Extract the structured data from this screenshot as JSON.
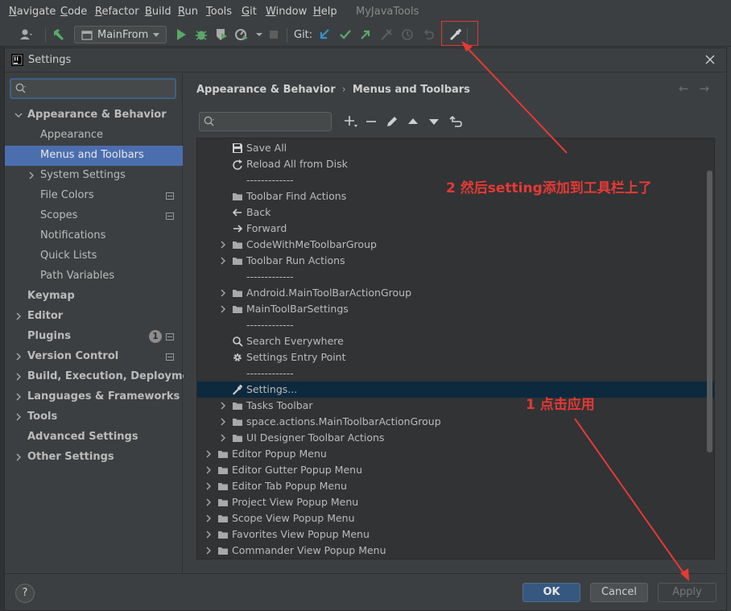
{
  "menubar": {
    "items": [
      "Navigate",
      "Code",
      "Refactor",
      "Build",
      "Run",
      "Tools",
      "Git",
      "Window",
      "Help"
    ],
    "app_title": "MyJavaTools"
  },
  "toolbar": {
    "run_config": "MainFrom",
    "git_label": "Git:"
  },
  "dialog": {
    "title": "Settings",
    "search_placeholder": "",
    "sidebar": [
      {
        "label": "Appearance & Behavior",
        "bold": true,
        "level": 0,
        "expanded": true
      },
      {
        "label": "Appearance",
        "bold": false,
        "level": 1
      },
      {
        "label": "Menus and Toolbars",
        "bold": false,
        "level": 1,
        "selected": true
      },
      {
        "label": "System Settings",
        "bold": false,
        "level": 1,
        "collapsed": true
      },
      {
        "label": "File Colors",
        "bold": false,
        "level": 1,
        "mark": true
      },
      {
        "label": "Scopes",
        "bold": false,
        "level": 1,
        "mark": true
      },
      {
        "label": "Notifications",
        "bold": false,
        "level": 1
      },
      {
        "label": "Quick Lists",
        "bold": false,
        "level": 1
      },
      {
        "label": "Path Variables",
        "bold": false,
        "level": 1
      },
      {
        "label": "Keymap",
        "bold": true,
        "level": 0
      },
      {
        "label": "Editor",
        "bold": true,
        "level": 0,
        "collapsed": true
      },
      {
        "label": "Plugins",
        "bold": true,
        "level": 0,
        "badge": "1",
        "mark": true
      },
      {
        "label": "Version Control",
        "bold": true,
        "level": 0,
        "collapsed": true,
        "mark": true
      },
      {
        "label": "Build, Execution, Deployment",
        "bold": true,
        "level": 0,
        "collapsed": true
      },
      {
        "label": "Languages & Frameworks",
        "bold": true,
        "level": 0,
        "collapsed": true
      },
      {
        "label": "Tools",
        "bold": true,
        "level": 0,
        "collapsed": true
      },
      {
        "label": "Advanced Settings",
        "bold": true,
        "level": 0
      },
      {
        "label": "Other Settings",
        "bold": true,
        "level": 0,
        "collapsed": true
      }
    ],
    "breadcrumb": [
      "Appearance & Behavior",
      "Menus and Toolbars"
    ],
    "actions_search_placeholder": "",
    "action_tree": [
      {
        "label": "Save All",
        "level": 2,
        "icon": "save-icon"
      },
      {
        "label": "Reload All from Disk",
        "level": 2,
        "icon": "reload-icon"
      },
      {
        "label": "-------------",
        "level": 2,
        "icon": ""
      },
      {
        "label": "Toolbar Find Actions",
        "level": 2,
        "icon": "folder-icon"
      },
      {
        "label": "Back",
        "level": 2,
        "icon": "arrow-left-icon"
      },
      {
        "label": "Forward",
        "level": 2,
        "icon": "arrow-right-icon"
      },
      {
        "label": "CodeWithMeToolbarGroup",
        "level": 2,
        "icon": "folder-icon",
        "expandable": true
      },
      {
        "label": "Toolbar Run Actions",
        "level": 2,
        "icon": "folder-icon",
        "expandable": true
      },
      {
        "label": "-------------",
        "level": 2,
        "icon": ""
      },
      {
        "label": "Android.MainToolBarActionGroup",
        "level": 2,
        "icon": "folder-icon",
        "expandable": true
      },
      {
        "label": "MainToolBarSettings",
        "level": 2,
        "icon": "folder-icon",
        "expandable": true
      },
      {
        "label": "-------------",
        "level": 2,
        "icon": ""
      },
      {
        "label": "Search Everywhere",
        "level": 2,
        "icon": "search-icon"
      },
      {
        "label": "Settings Entry Point",
        "level": 2,
        "icon": "gear-icon"
      },
      {
        "label": "-------------",
        "level": 2,
        "icon": ""
      },
      {
        "label": "Settings...",
        "level": 2,
        "icon": "wrench-icon",
        "selected": true
      },
      {
        "label": "Tasks Toolbar",
        "level": 2,
        "icon": "folder-icon",
        "expandable": true
      },
      {
        "label": "space.actions.MainToolbarActionGroup",
        "level": 2,
        "icon": "folder-icon",
        "expandable": true
      },
      {
        "label": "UI Designer Toolbar Actions",
        "level": 2,
        "icon": "folder-icon",
        "expandable": true
      },
      {
        "label": "Editor Popup Menu",
        "level": 1,
        "icon": "folder-icon",
        "expandable": true
      },
      {
        "label": "Editor Gutter Popup Menu",
        "level": 1,
        "icon": "folder-icon",
        "expandable": true
      },
      {
        "label": "Editor Tab Popup Menu",
        "level": 1,
        "icon": "folder-icon",
        "expandable": true
      },
      {
        "label": "Project View Popup Menu",
        "level": 1,
        "icon": "folder-icon",
        "expandable": true
      },
      {
        "label": "Scope View Popup Menu",
        "level": 1,
        "icon": "folder-icon",
        "expandable": true
      },
      {
        "label": "Favorites View Popup Menu",
        "level": 1,
        "icon": "folder-icon",
        "expandable": true
      },
      {
        "label": "Commander View Popup Menu",
        "level": 1,
        "icon": "folder-icon",
        "expandable": true
      }
    ],
    "buttons": {
      "ok": "OK",
      "cancel": "Cancel",
      "apply": "Apply",
      "help": "?"
    }
  },
  "annotations": {
    "step2": "2 然后setting添加到工具栏上了",
    "step1": "1 点击应用",
    "color": "#e53935"
  }
}
